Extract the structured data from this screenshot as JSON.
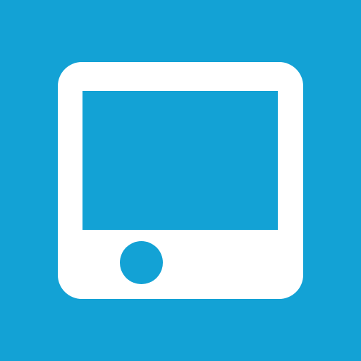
{
  "app_icon": {
    "icon": "tablet-device-icon",
    "colors": {
      "tile_background": "#13a2d5",
      "device_body": "#ffffff",
      "device_screen": "#13a2d5",
      "home_button": "#13a2d5"
    }
  }
}
